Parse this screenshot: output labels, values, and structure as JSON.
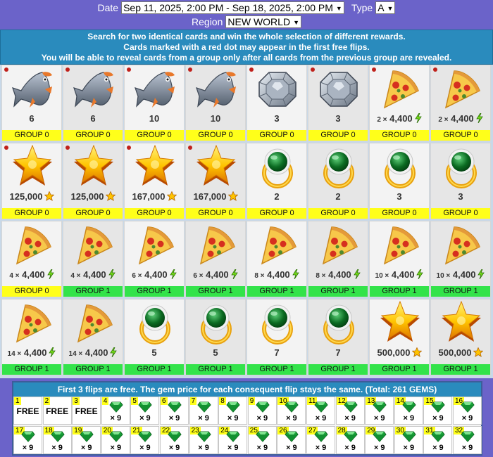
{
  "filters": {
    "date_label": "Date",
    "date_value": "Sep 11, 2025, 2:00 PM - Sep 18, 2025, 2:00 PM",
    "type_label": "Type",
    "type_value": "A",
    "region_label": "Region",
    "region_value": "NEW WORLD"
  },
  "banner": {
    "line1": "Search for two identical cards and win the whole selection of different rewards.",
    "line2": "Cards marked with a red dot may appear in the first free flips.",
    "line3": "You will be able to reveal cards from a group only after all cards from the previous group are revealed."
  },
  "cards": [
    {
      "icon": "fish-icon",
      "value": "6",
      "group": "GROUP 0",
      "dot": true
    },
    {
      "icon": "fish-icon",
      "value": "6",
      "group": "GROUP 0",
      "dot": true
    },
    {
      "icon": "fish-icon",
      "value": "10",
      "group": "GROUP 0",
      "dot": true
    },
    {
      "icon": "fish-icon",
      "value": "10",
      "group": "GROUP 0",
      "dot": true
    },
    {
      "icon": "diamond-icon",
      "value": "3",
      "group": "GROUP 0",
      "dot": true
    },
    {
      "icon": "diamond-icon",
      "value": "3",
      "group": "GROUP 0",
      "dot": true
    },
    {
      "icon": "pizza-icon",
      "mult": "2 ×",
      "value": "4,400",
      "unit": "energy-icon",
      "group": "GROUP 0",
      "dot": true
    },
    {
      "icon": "pizza-icon",
      "mult": "2 ×",
      "value": "4,400",
      "unit": "energy-icon",
      "group": "GROUP 0",
      "dot": true
    },
    {
      "icon": "star-icon",
      "value": "125,000",
      "unit": "star-icon",
      "group": "GROUP 0",
      "dot": true
    },
    {
      "icon": "star-icon",
      "value": "125,000",
      "unit": "star-icon",
      "group": "GROUP 0",
      "dot": true
    },
    {
      "icon": "star-icon",
      "value": "167,000",
      "unit": "star-icon",
      "group": "GROUP 0",
      "dot": true
    },
    {
      "icon": "star-icon",
      "value": "167,000",
      "unit": "star-icon",
      "group": "GROUP 0",
      "dot": true
    },
    {
      "icon": "emerald-ring-icon",
      "value": "2",
      "group": "GROUP 0",
      "dot": false
    },
    {
      "icon": "emerald-ring-icon",
      "value": "2",
      "group": "GROUP 0",
      "dot": false
    },
    {
      "icon": "emerald-ring-icon",
      "value": "3",
      "group": "GROUP 0",
      "dot": false
    },
    {
      "icon": "emerald-ring-icon",
      "value": "3",
      "group": "GROUP 0",
      "dot": false
    },
    {
      "icon": "pizza-icon",
      "mult": "4 ×",
      "value": "4,400",
      "unit": "energy-icon",
      "group": "GROUP 0",
      "dot": false
    },
    {
      "icon": "pizza-icon",
      "mult": "4 ×",
      "value": "4,400",
      "unit": "energy-icon",
      "group": "GROUP 1",
      "dot": false
    },
    {
      "icon": "pizza-icon",
      "mult": "6 ×",
      "value": "4,400",
      "unit": "energy-icon",
      "group": "GROUP 1",
      "dot": false
    },
    {
      "icon": "pizza-icon",
      "mult": "6 ×",
      "value": "4,400",
      "unit": "energy-icon",
      "group": "GROUP 1",
      "dot": false
    },
    {
      "icon": "pizza-icon",
      "mult": "8 ×",
      "value": "4,400",
      "unit": "energy-icon",
      "group": "GROUP 1",
      "dot": false
    },
    {
      "icon": "pizza-icon",
      "mult": "8 ×",
      "value": "4,400",
      "unit": "energy-icon",
      "group": "GROUP 1",
      "dot": false
    },
    {
      "icon": "pizza-icon",
      "mult": "10 ×",
      "value": "4,400",
      "unit": "energy-icon",
      "group": "GROUP 1",
      "dot": false
    },
    {
      "icon": "pizza-icon",
      "mult": "10 ×",
      "value": "4,400",
      "unit": "energy-icon",
      "group": "GROUP 1",
      "dot": false
    },
    {
      "icon": "pizza-icon",
      "mult": "14 ×",
      "value": "4,400",
      "unit": "energy-icon",
      "group": "GROUP 1",
      "dot": false
    },
    {
      "icon": "pizza-icon",
      "mult": "14 ×",
      "value": "4,400",
      "unit": "energy-icon",
      "group": "GROUP 1",
      "dot": false
    },
    {
      "icon": "emerald-ring-icon",
      "value": "5",
      "group": "GROUP 1",
      "dot": false
    },
    {
      "icon": "emerald-ring-icon",
      "value": "5",
      "group": "GROUP 1",
      "dot": false
    },
    {
      "icon": "emerald-ring-icon",
      "value": "7",
      "group": "GROUP 1",
      "dot": false
    },
    {
      "icon": "emerald-ring-icon",
      "value": "7",
      "group": "GROUP 1",
      "dot": false
    },
    {
      "icon": "star-icon",
      "value": "500,000",
      "unit": "star-icon",
      "group": "GROUP 1",
      "dot": false
    },
    {
      "icon": "star-icon",
      "value": "500,000",
      "unit": "star-icon",
      "group": "GROUP 1",
      "dot": false
    }
  ],
  "flips": {
    "title": "First 3 flips are free. The gem price for each consequent flip stays the same. (Total: 261 GEMS)",
    "free_label": "FREE",
    "cost_label": "× 9",
    "free_count": 3,
    "items": [
      "1",
      "2",
      "3",
      "4",
      "5",
      "6",
      "7",
      "8",
      "9",
      "10",
      "11",
      "12",
      "13",
      "14",
      "15",
      "16",
      "17",
      "18",
      "19",
      "20",
      "21",
      "22",
      "23",
      "24",
      "25",
      "26",
      "27",
      "28",
      "29",
      "30",
      "31",
      "32"
    ]
  },
  "colors": {
    "background": "#6b63c9",
    "banner": "#2a8bbd",
    "group0": "#ffff1a",
    "group1": "#33e34a",
    "red_dot": "#c0201a",
    "gem": "#1aa63a"
  }
}
